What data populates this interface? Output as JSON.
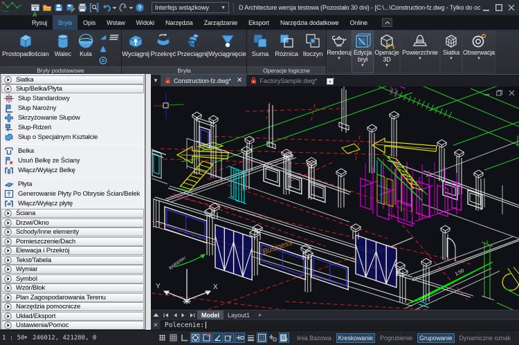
{
  "titlebar": {
    "title": "D Architecture wersja testowa (Pozostało 30 dni)  - [C:\\...\\Construction-fz.dwg - Tylko do oc",
    "interface_combo": "Interfejs wstążkowy",
    "quick_access_icons": [
      "new-file",
      "open-folder",
      "save",
      "save-as",
      "print",
      "print-preview",
      "undo",
      "redo",
      "help"
    ],
    "window_buttons": [
      "minimize",
      "maximize",
      "close"
    ]
  },
  "ribbon_tabs": {
    "items": [
      "Rysuj",
      "Bryła",
      "Opis",
      "Wstaw",
      "Widoki",
      "Narzędzia",
      "Zarządzanie",
      "Eksport",
      "Narzędzia dodatkowe",
      "Online"
    ],
    "active": "Bryła"
  },
  "ribbon": {
    "groups": [
      {
        "label": "Bryły podstawowe",
        "buttons": [
          "Prostopadłościan",
          "Walec",
          "Kula"
        ],
        "small_buttons": [
          "wedge",
          "cone",
          "torus",
          "layers"
        ]
      },
      {
        "label": "Bryła",
        "buttons": [
          "Wyciągnij",
          "Przekręć",
          "Przeciągnij",
          "Wyciągnięcie"
        ]
      },
      {
        "label": "Operacje logiczne",
        "buttons": [
          "Suma",
          "Różnica",
          "Iloczyn"
        ]
      }
    ],
    "tall_buttons": [
      {
        "label": "Renderuj",
        "line2": "",
        "icon": "teapot"
      },
      {
        "label": "Edycja",
        "line2": "brył",
        "icon": "solid-edit-cube"
      },
      {
        "label": "Operacje",
        "line2": "3D",
        "icon": "cube-rotate"
      },
      {
        "label": "Powierzchnie",
        "line2": "",
        "icon": "surface-dome"
      },
      {
        "label": "Siatka",
        "line2": "",
        "icon": "mesh-cube"
      },
      {
        "label": "Obserwacja",
        "line2": "",
        "icon": "orbit-eye"
      }
    ]
  },
  "palette": {
    "rows": [
      {
        "type": "header",
        "label": "Siatka",
        "state": "collapsed"
      },
      {
        "type": "header",
        "label": "Słup/Belka/Płyta",
        "state": "expanded"
      },
      {
        "type": "item",
        "label": "Słup Standardowy",
        "icon": "column-grid"
      },
      {
        "type": "item",
        "label": "Słup Narożny",
        "icon": "column-corner"
      },
      {
        "type": "item",
        "label": "Skrzyżowanie Słupów",
        "icon": "column-cross"
      },
      {
        "type": "item",
        "label": "Słup-Rdzeń",
        "icon": "column-core"
      },
      {
        "type": "item",
        "label": "Słup o Specjalnym Kształcie",
        "icon": "column-special"
      },
      {
        "type": "separator"
      },
      {
        "type": "item",
        "label": "Belka",
        "icon": "beam"
      },
      {
        "type": "item",
        "label": "Usuń Belkę ze Ściany",
        "icon": "beam-delete"
      },
      {
        "type": "item",
        "label": "Włącz/Wyłącz Belkę",
        "icon": "beam-toggle"
      },
      {
        "type": "separator"
      },
      {
        "type": "item",
        "label": "Płyta",
        "icon": "slab"
      },
      {
        "type": "item",
        "label": "Generowanie Płyty Po Obrysie Ścian/Belek",
        "icon": "slab-generate"
      },
      {
        "type": "item",
        "label": "Włącz/Wyłącz płytę",
        "icon": "slab-toggle"
      },
      {
        "type": "header",
        "label": "Ściana",
        "state": "collapsed"
      },
      {
        "type": "header",
        "label": "Drzwi/Okno",
        "state": "collapsed"
      },
      {
        "type": "header",
        "label": "Schody/Inne elementy",
        "state": "collapsed"
      },
      {
        "type": "header",
        "label": "Pomieszczenie/Dach",
        "state": "collapsed"
      },
      {
        "type": "header",
        "label": "Elewacja i Przekrój",
        "state": "collapsed"
      },
      {
        "type": "header",
        "label": "Tekst/Tabela",
        "state": "collapsed"
      },
      {
        "type": "header",
        "label": "Wymiar",
        "state": "collapsed"
      },
      {
        "type": "header",
        "label": "Symbol",
        "state": "collapsed"
      },
      {
        "type": "header",
        "label": "Wzór/Blok",
        "state": "collapsed"
      },
      {
        "type": "header",
        "label": "Plan Zagospodarowania Terenu",
        "state": "collapsed"
      },
      {
        "type": "header",
        "label": "Narzędzia pomocnicze",
        "state": "collapsed"
      },
      {
        "type": "header",
        "label": "Układ/Eksport",
        "state": "collapsed"
      },
      {
        "type": "header",
        "label": "Ustawienia/Pomoc",
        "state": "collapsed"
      }
    ]
  },
  "doc_tabs": {
    "tabs": [
      {
        "label": "Construction-fz.dwg*",
        "active": true,
        "locked": true,
        "closable": true
      },
      {
        "label": "FactorySample.dwg*",
        "active": false,
        "locked": true,
        "closable": false
      }
    ],
    "new_tab_icon": "new-document"
  },
  "canvas": {
    "texts": {
      "business": "Business",
      "ramp_slope": "1:50",
      "leader": "BARIERKI"
    },
    "ucs": {
      "x": "X",
      "y": "Y"
    },
    "palette_colors": {
      "lines": "#e6e6e6",
      "grid": "#cc2222",
      "terrain": "#22cc22",
      "stairs": "#e8e800",
      "doors": "#00d8d8",
      "interior": "#e000e0",
      "glass": "#2222dd",
      "annotation": "#c87828"
    }
  },
  "layout_tabs": {
    "items": [
      "Model",
      "Layout1",
      "+"
    ],
    "active": "Model"
  },
  "command_line": {
    "prompt": "Polecenie:"
  },
  "statusbar": {
    "scale": "1 : 50",
    "coordinates": "246012, 421280, 0",
    "icons": [
      {
        "name": "grid-snap",
        "on": false
      },
      {
        "name": "grid-display",
        "on": false
      },
      {
        "name": "ortho",
        "on": false
      },
      {
        "name": "osnap",
        "on": true
      },
      {
        "name": "polar-tracking",
        "on": true
      },
      {
        "name": "angle-snap",
        "on": true
      },
      {
        "name": "dynamic-input",
        "on": true
      },
      {
        "name": "object-tracking",
        "on": true
      },
      {
        "name": "lineweight",
        "on": false
      },
      {
        "name": "hatch-display",
        "on": true
      },
      {
        "name": "annotation-add",
        "on": false
      },
      {
        "name": "calculator-panel",
        "on": true
      }
    ],
    "toggles": [
      {
        "label": "linia Bazowa",
        "on": false
      },
      {
        "label": "Kreskowanie",
        "on": true
      },
      {
        "label": "Pogrubienie",
        "on": false
      },
      {
        "label": "Grupowanie",
        "on": true
      },
      {
        "label": "Dynamiczne oznak",
        "on": false
      }
    ]
  }
}
